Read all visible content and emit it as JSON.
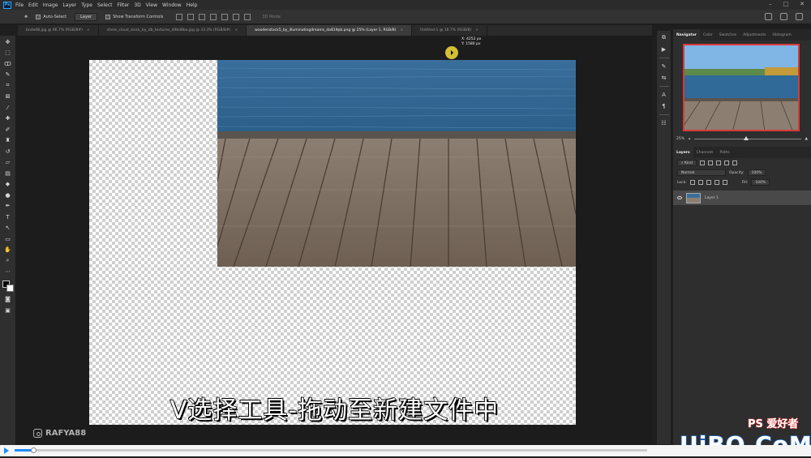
{
  "menubar": {
    "items": [
      "File",
      "Edit",
      "Image",
      "Layer",
      "Type",
      "Select",
      "Filter",
      "3D",
      "View",
      "Window",
      "Help"
    ],
    "app_badge": "Ps"
  },
  "options": {
    "auto_select_label": "Auto-Select",
    "auto_select_value": "Layer",
    "transform_label": "Show Transform Controls",
    "mode_label": "3D Mode:"
  },
  "tabs": [
    {
      "label": "bnde08.jpg @ 66.7% (RGB/8#)",
      "active": false
    },
    {
      "label": "shore_cloud_stock_by_db_textures_d0bd8ba.jpg @ 33.3% (RGB/8#)",
      "active": false
    },
    {
      "label": "woodenstock5_by_illuminatingdreams_da819pb.png @ 25% (Layer 1, RGB/8)",
      "active": true
    },
    {
      "label": "Untitled-1 @ 16.7% (RGB/8)",
      "active": false
    }
  ],
  "canvas": {
    "tooltip_x": "X: 4252 px",
    "tooltip_y": "Y: 1580 px",
    "subtitle": "V选择工具-拖动至新建文件中",
    "watermark": "RAFYA88"
  },
  "panels": {
    "top_tabs": [
      "Navigator",
      "Color",
      "Swatches",
      "Adjustments",
      "Histogram"
    ],
    "zoom_label": "25%",
    "layers_tabs": [
      "Layers",
      "Channels",
      "Paths"
    ],
    "kind_label": "Kind",
    "blend_mode": "Normal",
    "opacity_label": "Opacity:",
    "opacity_value": "100%",
    "lock_label": "Lock:",
    "fill_label": "Fill:",
    "fill_value": "100%",
    "layer_name": "Layer 1"
  },
  "video": {
    "progress": 0.03
  },
  "branding": {
    "site": "UiBQ.CoM",
    "badge": "PS 爱好者"
  }
}
